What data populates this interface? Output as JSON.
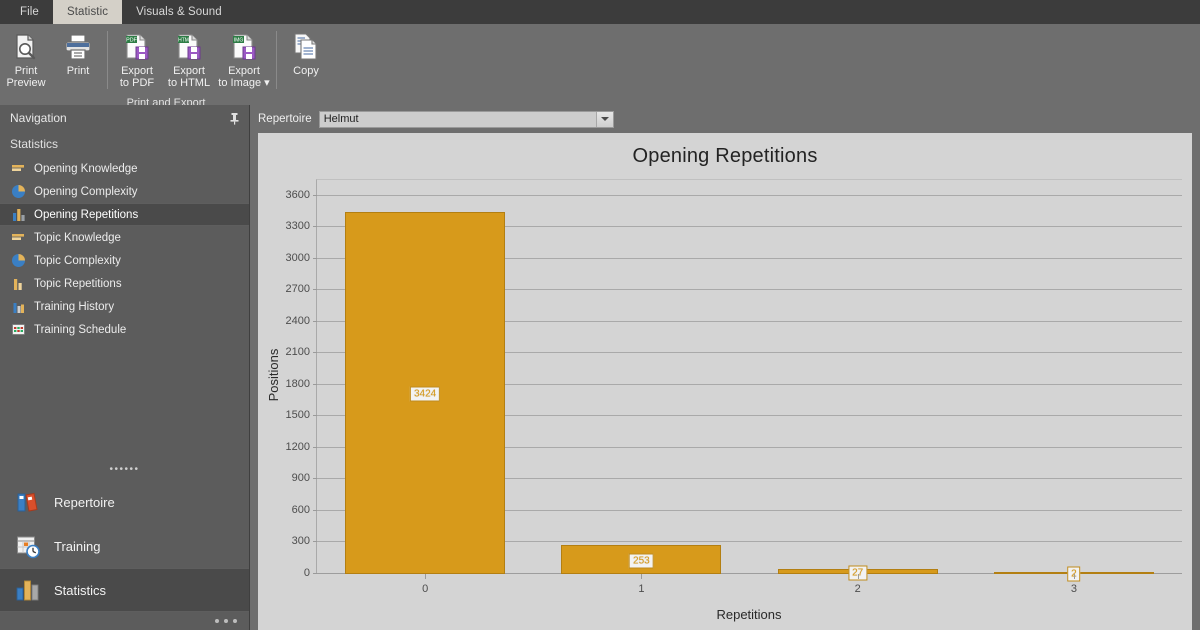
{
  "window": {
    "tabs": [
      {
        "label": "File",
        "active": false
      },
      {
        "label": "Statistic",
        "active": true
      },
      {
        "label": "Visuals & Sound",
        "active": false
      }
    ]
  },
  "ribbon": {
    "group_label": "Print and Export",
    "buttons": [
      {
        "label": "Print\nPreview",
        "icon": "print-preview-icon"
      },
      {
        "label": "Print",
        "icon": "printer-icon"
      },
      {
        "label": "Export\nto PDF",
        "icon": "export-pdf-icon"
      },
      {
        "label": "Export\nto HTML",
        "icon": "export-html-icon"
      },
      {
        "label": "Export\nto Image ▾",
        "icon": "export-image-icon"
      },
      {
        "label": "Copy",
        "icon": "copy-icon"
      }
    ]
  },
  "sidebar": {
    "header": "Navigation",
    "pin_icon": "pin-icon",
    "section_title": "Statistics",
    "items": [
      {
        "label": "Opening Knowledge",
        "icon": "bar-horizontal-icon",
        "selected": false
      },
      {
        "label": "Opening Complexity",
        "icon": "pie-chart-icon",
        "selected": false
      },
      {
        "label": "Opening Repetitions",
        "icon": "bar-chart-icon",
        "selected": true
      },
      {
        "label": "Topic Knowledge",
        "icon": "bar-horizontal-icon",
        "selected": false
      },
      {
        "label": "Topic Complexity",
        "icon": "pie-chart-icon",
        "selected": false
      },
      {
        "label": "Topic Repetitions",
        "icon": "bar-chart-icon",
        "selected": false
      },
      {
        "label": "Training History",
        "icon": "history-chart-icon",
        "selected": false
      },
      {
        "label": "Training Schedule",
        "icon": "calendar-icon",
        "selected": false
      }
    ],
    "dots": "••••••",
    "modules": [
      {
        "label": "Repertoire",
        "icon": "books-icon",
        "selected": false
      },
      {
        "label": "Training",
        "icon": "calendar-clock-icon",
        "selected": false
      },
      {
        "label": "Statistics",
        "icon": "bar-chart-color-icon",
        "selected": true
      }
    ]
  },
  "toolbar": {
    "repertoire_label": "Repertoire",
    "repertoire_value": "Helmut",
    "dropdown_icon": "chevron-down-icon"
  },
  "colors": {
    "bar": "#d79a1b",
    "bar_border": "#b37f12",
    "panel_bg": "#d4d4d4",
    "chrome": "#6e6e6e",
    "sidebar": "#5c5c5c",
    "selection": "#4a4a4a"
  },
  "chart_data": {
    "type": "bar",
    "title": "Opening Repetitions",
    "xlabel": "Repetitions",
    "ylabel": "Positions",
    "categories": [
      "0",
      "1",
      "2",
      "3"
    ],
    "values": [
      3424,
      253,
      27,
      2
    ],
    "data_labels": [
      "3424",
      "253",
      "27",
      "2"
    ],
    "ylim": [
      0,
      3750
    ],
    "yticks": [
      0,
      300,
      600,
      900,
      1200,
      1500,
      1800,
      2100,
      2400,
      2700,
      3000,
      3300,
      3600
    ],
    "ytick_labels": [
      "0",
      "300",
      "600",
      "900",
      "1200",
      "1500",
      "1800",
      "2100",
      "2400",
      "2700",
      "3000",
      "3300",
      "3600"
    ],
    "grid": true,
    "legend": false,
    "bar_color": "#d79a1b"
  }
}
